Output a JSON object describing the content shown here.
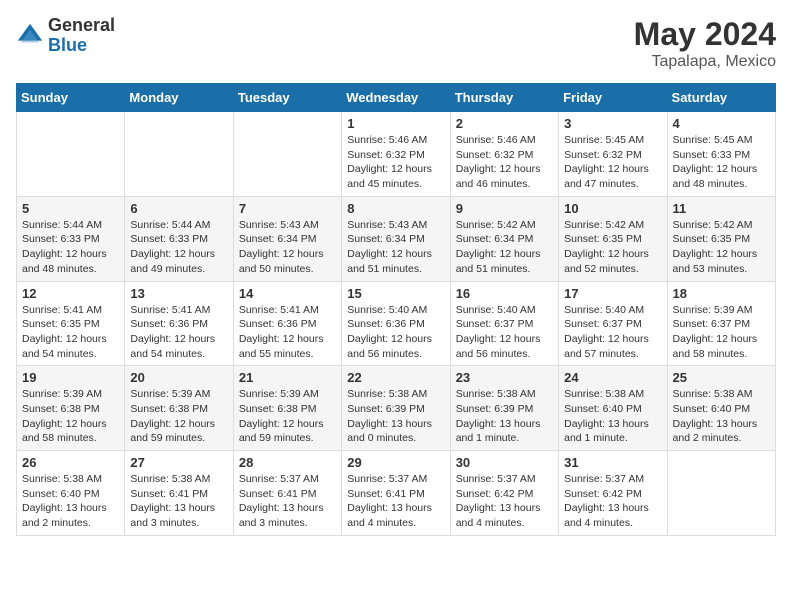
{
  "logo": {
    "general": "General",
    "blue": "Blue"
  },
  "header": {
    "month_year": "May 2024",
    "location": "Tapalapa, Mexico"
  },
  "days_of_week": [
    "Sunday",
    "Monday",
    "Tuesday",
    "Wednesday",
    "Thursday",
    "Friday",
    "Saturday"
  ],
  "weeks": [
    [
      {
        "day": "",
        "sunrise": "",
        "sunset": "",
        "daylight": ""
      },
      {
        "day": "",
        "sunrise": "",
        "sunset": "",
        "daylight": ""
      },
      {
        "day": "",
        "sunrise": "",
        "sunset": "",
        "daylight": ""
      },
      {
        "day": "1",
        "sunrise": "Sunrise: 5:46 AM",
        "sunset": "Sunset: 6:32 PM",
        "daylight": "Daylight: 12 hours and 45 minutes."
      },
      {
        "day": "2",
        "sunrise": "Sunrise: 5:46 AM",
        "sunset": "Sunset: 6:32 PM",
        "daylight": "Daylight: 12 hours and 46 minutes."
      },
      {
        "day": "3",
        "sunrise": "Sunrise: 5:45 AM",
        "sunset": "Sunset: 6:32 PM",
        "daylight": "Daylight: 12 hours and 47 minutes."
      },
      {
        "day": "4",
        "sunrise": "Sunrise: 5:45 AM",
        "sunset": "Sunset: 6:33 PM",
        "daylight": "Daylight: 12 hours and 48 minutes."
      }
    ],
    [
      {
        "day": "5",
        "sunrise": "Sunrise: 5:44 AM",
        "sunset": "Sunset: 6:33 PM",
        "daylight": "Daylight: 12 hours and 48 minutes."
      },
      {
        "day": "6",
        "sunrise": "Sunrise: 5:44 AM",
        "sunset": "Sunset: 6:33 PM",
        "daylight": "Daylight: 12 hours and 49 minutes."
      },
      {
        "day": "7",
        "sunrise": "Sunrise: 5:43 AM",
        "sunset": "Sunset: 6:34 PM",
        "daylight": "Daylight: 12 hours and 50 minutes."
      },
      {
        "day": "8",
        "sunrise": "Sunrise: 5:43 AM",
        "sunset": "Sunset: 6:34 PM",
        "daylight": "Daylight: 12 hours and 51 minutes."
      },
      {
        "day": "9",
        "sunrise": "Sunrise: 5:42 AM",
        "sunset": "Sunset: 6:34 PM",
        "daylight": "Daylight: 12 hours and 51 minutes."
      },
      {
        "day": "10",
        "sunrise": "Sunrise: 5:42 AM",
        "sunset": "Sunset: 6:35 PM",
        "daylight": "Daylight: 12 hours and 52 minutes."
      },
      {
        "day": "11",
        "sunrise": "Sunrise: 5:42 AM",
        "sunset": "Sunset: 6:35 PM",
        "daylight": "Daylight: 12 hours and 53 minutes."
      }
    ],
    [
      {
        "day": "12",
        "sunrise": "Sunrise: 5:41 AM",
        "sunset": "Sunset: 6:35 PM",
        "daylight": "Daylight: 12 hours and 54 minutes."
      },
      {
        "day": "13",
        "sunrise": "Sunrise: 5:41 AM",
        "sunset": "Sunset: 6:36 PM",
        "daylight": "Daylight: 12 hours and 54 minutes."
      },
      {
        "day": "14",
        "sunrise": "Sunrise: 5:41 AM",
        "sunset": "Sunset: 6:36 PM",
        "daylight": "Daylight: 12 hours and 55 minutes."
      },
      {
        "day": "15",
        "sunrise": "Sunrise: 5:40 AM",
        "sunset": "Sunset: 6:36 PM",
        "daylight": "Daylight: 12 hours and 56 minutes."
      },
      {
        "day": "16",
        "sunrise": "Sunrise: 5:40 AM",
        "sunset": "Sunset: 6:37 PM",
        "daylight": "Daylight: 12 hours and 56 minutes."
      },
      {
        "day": "17",
        "sunrise": "Sunrise: 5:40 AM",
        "sunset": "Sunset: 6:37 PM",
        "daylight": "Daylight: 12 hours and 57 minutes."
      },
      {
        "day": "18",
        "sunrise": "Sunrise: 5:39 AM",
        "sunset": "Sunset: 6:37 PM",
        "daylight": "Daylight: 12 hours and 58 minutes."
      }
    ],
    [
      {
        "day": "19",
        "sunrise": "Sunrise: 5:39 AM",
        "sunset": "Sunset: 6:38 PM",
        "daylight": "Daylight: 12 hours and 58 minutes."
      },
      {
        "day": "20",
        "sunrise": "Sunrise: 5:39 AM",
        "sunset": "Sunset: 6:38 PM",
        "daylight": "Daylight: 12 hours and 59 minutes."
      },
      {
        "day": "21",
        "sunrise": "Sunrise: 5:39 AM",
        "sunset": "Sunset: 6:38 PM",
        "daylight": "Daylight: 12 hours and 59 minutes."
      },
      {
        "day": "22",
        "sunrise": "Sunrise: 5:38 AM",
        "sunset": "Sunset: 6:39 PM",
        "daylight": "Daylight: 13 hours and 0 minutes."
      },
      {
        "day": "23",
        "sunrise": "Sunrise: 5:38 AM",
        "sunset": "Sunset: 6:39 PM",
        "daylight": "Daylight: 13 hours and 1 minute."
      },
      {
        "day": "24",
        "sunrise": "Sunrise: 5:38 AM",
        "sunset": "Sunset: 6:40 PM",
        "daylight": "Daylight: 13 hours and 1 minute."
      },
      {
        "day": "25",
        "sunrise": "Sunrise: 5:38 AM",
        "sunset": "Sunset: 6:40 PM",
        "daylight": "Daylight: 13 hours and 2 minutes."
      }
    ],
    [
      {
        "day": "26",
        "sunrise": "Sunrise: 5:38 AM",
        "sunset": "Sunset: 6:40 PM",
        "daylight": "Daylight: 13 hours and 2 minutes."
      },
      {
        "day": "27",
        "sunrise": "Sunrise: 5:38 AM",
        "sunset": "Sunset: 6:41 PM",
        "daylight": "Daylight: 13 hours and 3 minutes."
      },
      {
        "day": "28",
        "sunrise": "Sunrise: 5:37 AM",
        "sunset": "Sunset: 6:41 PM",
        "daylight": "Daylight: 13 hours and 3 minutes."
      },
      {
        "day": "29",
        "sunrise": "Sunrise: 5:37 AM",
        "sunset": "Sunset: 6:41 PM",
        "daylight": "Daylight: 13 hours and 4 minutes."
      },
      {
        "day": "30",
        "sunrise": "Sunrise: 5:37 AM",
        "sunset": "Sunset: 6:42 PM",
        "daylight": "Daylight: 13 hours and 4 minutes."
      },
      {
        "day": "31",
        "sunrise": "Sunrise: 5:37 AM",
        "sunset": "Sunset: 6:42 PM",
        "daylight": "Daylight: 13 hours and 4 minutes."
      },
      {
        "day": "",
        "sunrise": "",
        "sunset": "",
        "daylight": ""
      }
    ]
  ]
}
